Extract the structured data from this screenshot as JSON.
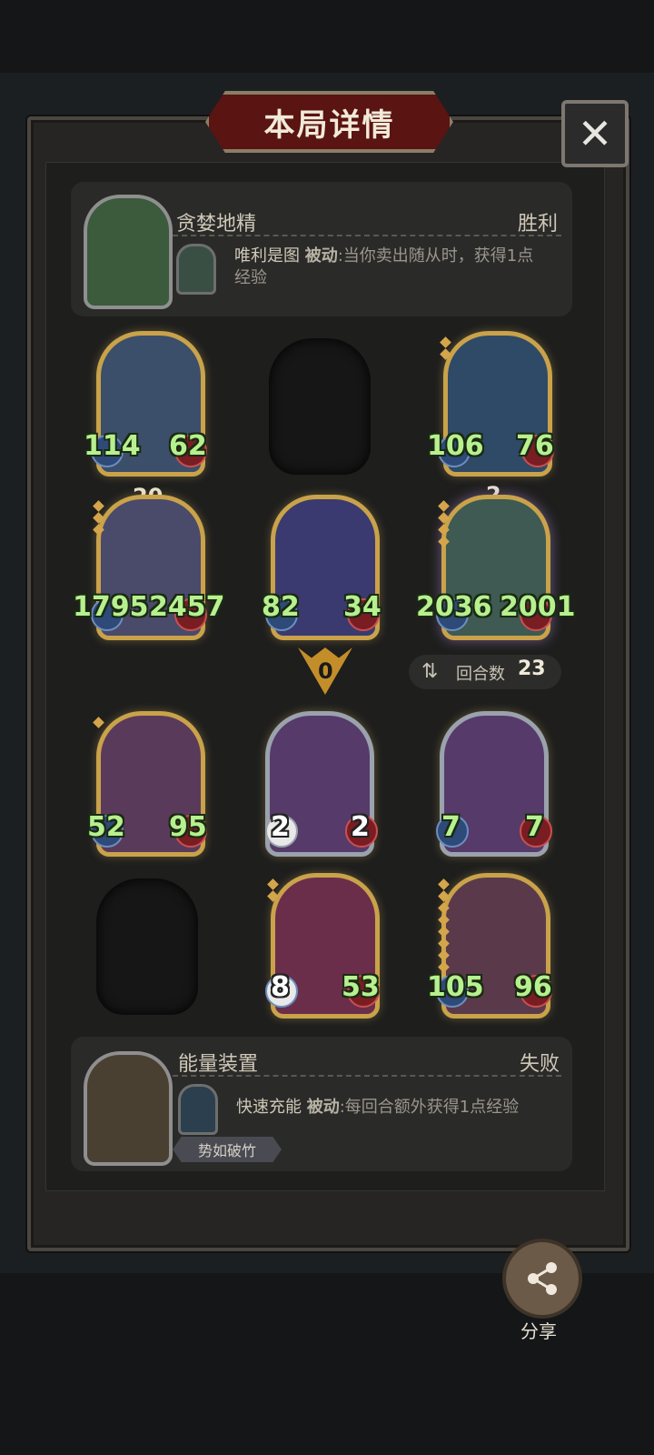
{
  "title": "本局详情",
  "close_label": "✕",
  "players": [
    {
      "name": "贪婪地精",
      "result": "胜利",
      "skill_name": "唯利是图",
      "skill_type": "被动",
      "skill_desc_line1": ":当你卖出随从时，获得1点",
      "skill_desc_line2": "经验"
    },
    {
      "name": "能量装置",
      "result": "失败",
      "skill_name": "快速充能",
      "skill_type": "被动",
      "skill_desc_line1": ":每回合额外获得1点经验",
      "badge": "势如破竹"
    }
  ],
  "top_board": [
    {
      "atk": "114",
      "hp": "62"
    },
    {
      "atk": "106",
      "hp": "76"
    },
    {
      "atk": "1795",
      "hp": "2457",
      "level": "20"
    },
    {
      "atk": "82",
      "hp": "34"
    },
    {
      "atk": "2036",
      "hp": "2001",
      "level": "2"
    }
  ],
  "divider_value": "0",
  "round": {
    "label": "回合数",
    "value": "23"
  },
  "bottom_board": [
    {
      "atk": "52",
      "hp": "95"
    },
    {
      "atk": "2",
      "hp": "2"
    },
    {
      "atk": "7",
      "hp": "7"
    },
    {
      "atk": "8",
      "hp": "53"
    },
    {
      "atk": "105",
      "hp": "96"
    }
  ],
  "share_label": "分享"
}
